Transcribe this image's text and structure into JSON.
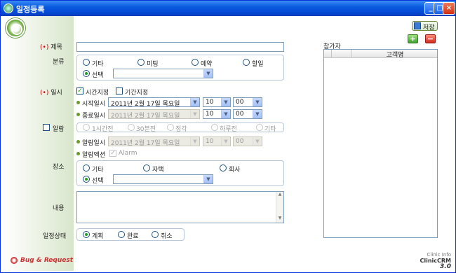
{
  "window": {
    "title": "일정등록"
  },
  "toolbar": {
    "save_label": "저장"
  },
  "form": {
    "title_label": "제목",
    "required_mark": "(•)",
    "title_value": "",
    "category_label": "분류",
    "category_options": [
      "기타",
      "미팅",
      "예약",
      "할일"
    ],
    "category_select_label": "선택",
    "category_select_value": "",
    "datetime_label": "일시",
    "time_specified_label": "시간지정",
    "period_specified_label": "기간지정",
    "start_label": "시작일시",
    "start_date": "2011년  2월 17일 목요일",
    "start_hour": "10",
    "start_minute": "00",
    "end_label": "종료일시",
    "end_date": "2011년  2월 17일 목요일",
    "end_hour": "10",
    "end_minute": "00",
    "alarm_label": "알람",
    "alarm_options": [
      "1시간전",
      "30분전",
      "정각",
      "하루전",
      "기타"
    ],
    "alarm_time_label": "알람일시",
    "alarm_date": "2011년  2월 17일 목요일",
    "alarm_hour": "10",
    "alarm_minute": "00",
    "alarm_action_label": "알람액션",
    "alarm_action_value": "Alarm",
    "place_label": "장소",
    "place_options": [
      "기타",
      "자택",
      "회사"
    ],
    "place_select_label": "선택",
    "place_select_value": "",
    "content_label": "내용",
    "content_value": "",
    "status_label": "일정상태",
    "status_options": [
      "계획",
      "완료",
      "취소"
    ]
  },
  "participants": {
    "label": "참가자",
    "column_header": "고객명"
  },
  "footer": {
    "bug_label": "Bug & Request",
    "brand_small": "Clinic Info",
    "brand": "ClinicCRM",
    "version": "3.0"
  },
  "colors": {
    "titlebar": "#0548d3",
    "accent": "#6b9c2a",
    "required": "#cc0000"
  }
}
